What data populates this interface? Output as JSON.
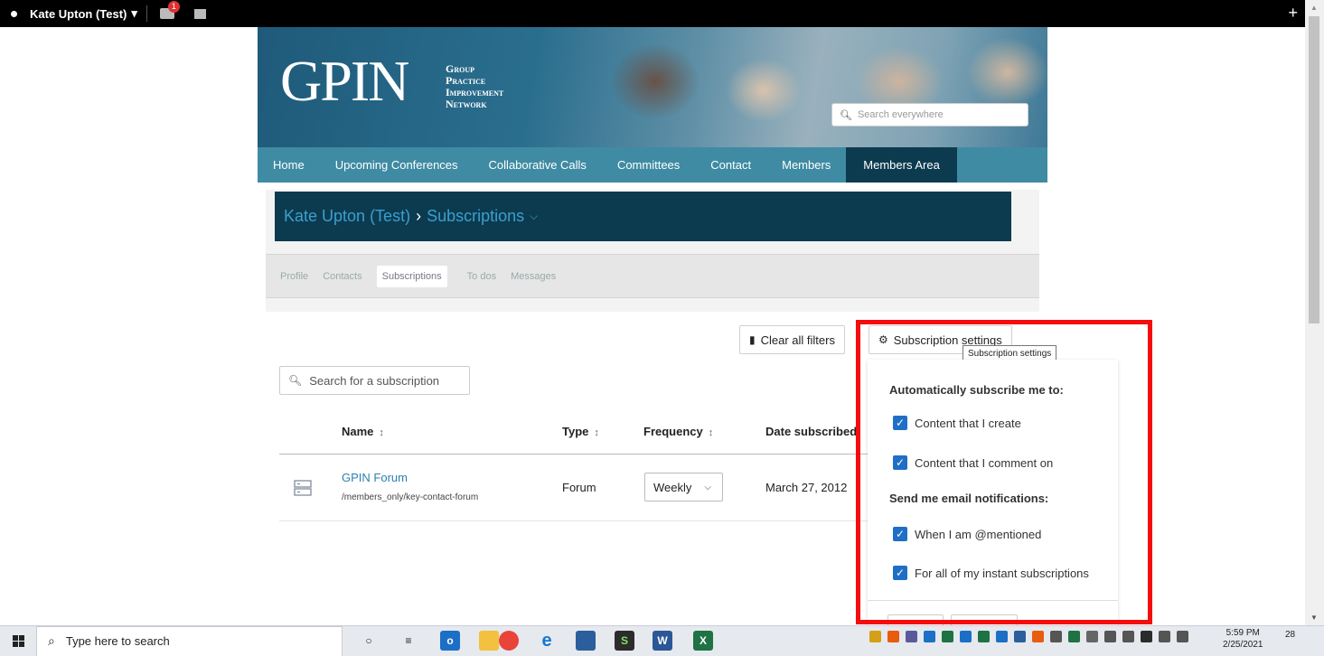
{
  "topbar": {
    "user": "Kate Upton (Test)",
    "caret": "▾",
    "badge": "1",
    "plus": "+"
  },
  "banner": {
    "logo": "GPIN",
    "logo_lines": [
      "Group",
      "Practice",
      "Improvement",
      "Network"
    ],
    "search_placeholder": "Search everywhere"
  },
  "nav": {
    "items": [
      "Home",
      "Upcoming Conferences",
      "Collaborative Calls",
      "Committees",
      "Contact",
      "Members",
      "Members Area"
    ],
    "active": "Members Area"
  },
  "breadcrumb": {
    "user": "Kate Upton (Test)",
    "sep": "›",
    "page": "Subscriptions"
  },
  "subtabs": [
    "Profile",
    "Contacts",
    "Subscriptions",
    "To dos",
    "Messages"
  ],
  "buttons": {
    "clear_filters": "Clear all filters",
    "subscription_settings": "Subscription settings"
  },
  "tooltip": "Subscription settings",
  "search": {
    "placeholder": "Search for a subscription"
  },
  "table": {
    "headers": {
      "name": "Name",
      "type": "Type",
      "frequency": "Frequency",
      "date": "Date subscribed"
    },
    "sort_glyph": "⌃",
    "rows": [
      {
        "title": "GPIN Forum",
        "path": "/members_only/key-contact-forum",
        "type": "Forum",
        "frequency": "Weekly",
        "date": "March 27, 2012"
      }
    ]
  },
  "settings_panel": {
    "auto_heading": "Automatically subscribe me to:",
    "auto_options": [
      "Content that I create",
      "Content that I comment on"
    ],
    "email_heading": "Send me email notifications:",
    "email_options": [
      "When I am @mentioned",
      "For all of my instant subscriptions"
    ]
  },
  "taskbar": {
    "search_placeholder": "Type here to search",
    "time": "5:59 PM",
    "date": "2/25/2021",
    "notifications": "28"
  },
  "colors": {
    "highlight": "#f50c0c",
    "nav_bg": "#3f8ba3",
    "nav_active": "#0c3b4f",
    "link": "#2e7fb0",
    "checkbox": "#1f6fc6"
  }
}
